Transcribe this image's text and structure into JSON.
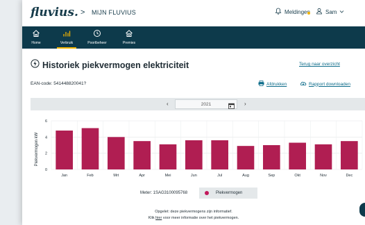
{
  "header": {
    "logo": "fluvius.",
    "breadcrumb_sep": ">",
    "breadcrumb": "MIJN FLUVIUS",
    "notifications_label": "Meldingen",
    "user_name": "Sam"
  },
  "nav": {
    "items": [
      {
        "label": "Home",
        "icon": "house-icon",
        "active": false
      },
      {
        "label": "Verbruik",
        "icon": "bar-chart-icon",
        "active": true
      },
      {
        "label": "Poortbeheer",
        "icon": "meter-icon",
        "active": false
      },
      {
        "label": "Premies",
        "icon": "premium-house-icon",
        "active": false
      }
    ]
  },
  "page": {
    "title": "Historiek piekvermogen elektriciteit",
    "back_link": "Terug naar overzicht",
    "ean_label": "EAN-code: 541448820041?",
    "print_label": "Afdrukken",
    "download_label": "Rapport downloaden",
    "year": "2021",
    "prev_arrow": "‹",
    "next_arrow": "›"
  },
  "legend": {
    "meter_label": "Meter: 1SAG3100095768",
    "series_label": "Piekvermogen"
  },
  "notes": {
    "line1": "Opgelet: deze piekvermogens zijn informatief.",
    "line2_prefix": "Klik ",
    "line2_link": "hier",
    "line2_suffix": " voor meer informatie over het piekvermogen."
  },
  "colors": {
    "nav_bg": "#0d3a4b",
    "accent": "#f2b400",
    "bar": "#b01e52",
    "link": "#0d6c8a"
  },
  "chart_data": {
    "type": "bar",
    "categories": [
      "Jan",
      "Feb",
      "Mrt",
      "Apr",
      "Mei",
      "Jun",
      "Jul",
      "Aug",
      "Sep",
      "Okt",
      "Nov",
      "Dec"
    ],
    "series": [
      {
        "name": "Piekvermogen",
        "values": [
          4.8,
          5.1,
          4.0,
          3.5,
          3.1,
          3.6,
          3.6,
          2.9,
          3.0,
          3.3,
          3.1,
          3.5
        ]
      }
    ],
    "ylabel": "Piekvermogen kW",
    "ylim": [
      0,
      6
    ],
    "yticks": [
      0,
      2,
      4,
      6
    ],
    "grid": true
  }
}
